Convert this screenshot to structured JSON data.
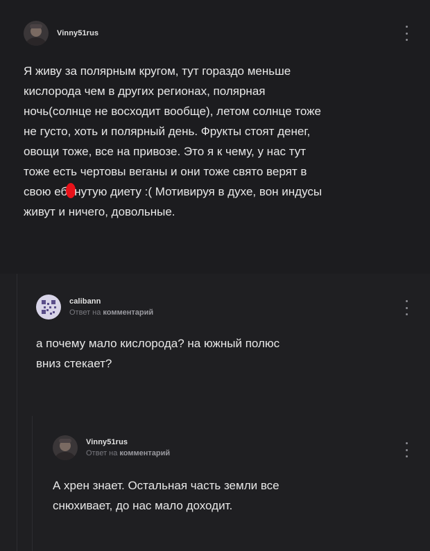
{
  "comments": [
    {
      "author": "Vinny51rus",
      "avatar": "avatar-photo",
      "text_before": "Я живу за полярным кругом, тут гораздо меньше\nкислорода чем в других регионах, полярная\nночь(солнце не восходит вообще), летом солнце тоже\nне густо, хоть и полярный день. Фрукты стоят денег,\nовощи тоже, все на привозе. Это я к чему, у нас тут\nтоже есть чертовы веганы и они тоже свято верят в\nсвою еб",
      "text_after": "нутую диету :(  Мотивируя в духе, вон индусы\nживут и ничего, довольные.",
      "menu_icon": "kebab-icon"
    },
    {
      "author": "calibann",
      "avatar": "avatar-qr",
      "reply_prefix": "Ответ на",
      "reply_target": "комментарий",
      "text": "а почему мало кислорода? на южный полюс\nвниз стекает?",
      "menu_icon": "kebab-icon"
    },
    {
      "author": "Vinny51rus",
      "avatar": "avatar-photo",
      "reply_prefix": "Ответ на",
      "reply_target": "комментарий",
      "text": "А хрен знает. Остальная часть земли все\nснюхивает, до нас мало доходит.",
      "menu_icon": "kebab-icon"
    }
  ],
  "colors": {
    "background": "#1e1e21",
    "text": "#e8e8e8",
    "muted": "#7a7a80",
    "redaction": "#e8121a"
  }
}
